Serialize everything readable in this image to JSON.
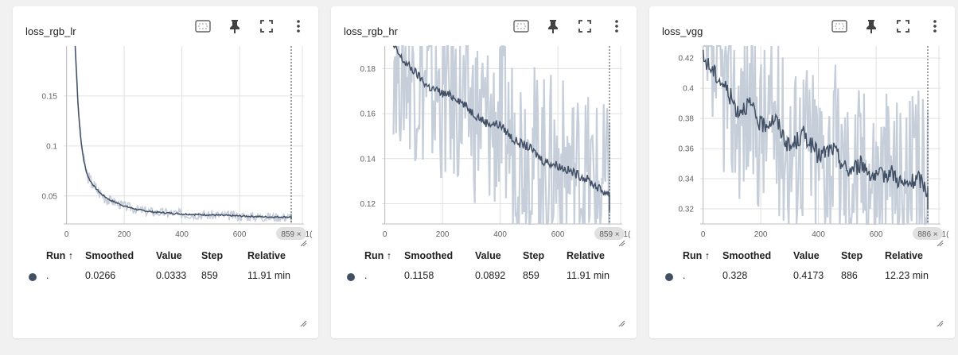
{
  "cards": [
    {
      "title": "loss_rgb_lr",
      "chart_data": {
        "type": "line",
        "ylim": [
          0.022,
          0.2
        ],
        "xlim": [
          -10,
          1000
        ],
        "xticks": [
          0,
          200,
          400,
          600,
          800
        ],
        "xtick_labels": [
          "0",
          "200",
          "400",
          "600",
          "8("
        ],
        "xtick_tail": "1(",
        "yticks": [
          0.05,
          0.1,
          0.15
        ],
        "ytick_labels": [
          "0.05",
          "0.1",
          "0.15"
        ],
        "cursor_step": 859,
        "cursor_label": "859 ×",
        "series": [
          {
            "name": "smoothed",
            "x": [
              30,
              40,
              50,
              60,
              70,
              80,
              100,
              120,
              150,
              200,
              250,
              300,
              400,
              500,
              600,
              700,
              800,
              859
            ],
            "y": [
              0.2,
              0.14,
              0.105,
              0.085,
              0.073,
              0.066,
              0.058,
              0.052,
              0.046,
              0.04,
              0.036,
              0.034,
              0.032,
              0.031,
              0.03,
              0.029,
              0.029,
              0.027
            ]
          },
          {
            "name": "raw",
            "x": [
              30,
              40,
              50,
              60,
              70,
              80,
              100,
              120,
              150,
              200,
              250,
              300,
              400,
              500,
              600,
              700,
              800,
              859
            ],
            "y": [
              0.2,
              0.15,
              0.115,
              0.095,
              0.08,
              0.07,
              0.062,
              0.055,
              0.05,
              0.044,
              0.04,
              0.037,
              0.035,
              0.034,
              0.033,
              0.032,
              0.031,
              0.03
            ]
          }
        ]
      },
      "table": {
        "run": ".",
        "smoothed": "0.0266",
        "value": "0.0333",
        "step": "859",
        "relative": "11.91 min"
      }
    },
    {
      "title": "loss_rgb_hr",
      "chart_data": {
        "type": "line",
        "ylim": [
          0.111,
          0.19
        ],
        "xlim": [
          -10,
          1000
        ],
        "xticks": [
          0,
          200,
          400,
          600,
          800
        ],
        "xtick_labels": [
          "0",
          "200",
          "400",
          "600",
          "8("
        ],
        "xtick_tail": "1(",
        "yticks": [
          0.12,
          0.14,
          0.16,
          0.18
        ],
        "ytick_labels": [
          "0.12",
          "0.14",
          "0.16",
          "0.18"
        ],
        "cursor_step": 859,
        "cursor_label": "859 ×",
        "series": [
          {
            "name": "smoothed",
            "x": [
              30,
              60,
              100,
              150,
              200,
              250,
              300,
              350,
              400,
              450,
              500,
              550,
              600,
              650,
              700,
              750,
              800,
              859
            ],
            "y": [
              0.19,
              0.184,
              0.179,
              0.172,
              0.169,
              0.167,
              0.161,
              0.156,
              0.155,
              0.148,
              0.145,
              0.139,
              0.137,
              0.134,
              0.131,
              0.126,
              0.123,
              0.117
            ]
          },
          {
            "name": "raw",
            "x": [
              30,
              100,
              200,
              300,
              400,
              500,
              600,
              700,
              800,
              859
            ],
            "y": [
              0.19,
              0.16,
              0.17,
              0.15,
              0.16,
              0.14,
              0.13,
              0.12,
              0.12,
              0.115
            ]
          }
        ]
      },
      "table": {
        "run": ".",
        "smoothed": "0.1158",
        "value": "0.0892",
        "step": "859",
        "relative": "11.91 min"
      }
    },
    {
      "title": "loss_vgg",
      "chart_data": {
        "type": "line",
        "ylim": [
          0.31,
          0.428
        ],
        "xlim": [
          -10,
          1000
        ],
        "xticks": [
          0,
          200,
          400,
          600,
          800
        ],
        "xtick_labels": [
          "0",
          "200",
          "400",
          "600",
          "80("
        ],
        "xtick_tail": "1(",
        "yticks": [
          0.32,
          0.34,
          0.36,
          0.38,
          0.4,
          0.42
        ],
        "ytick_labels": [
          "0.32",
          "0.34",
          "0.36",
          "0.38",
          "0.4",
          "0.42"
        ],
        "cursor_step": 886,
        "cursor_label": "886 ×",
        "series": [
          {
            "name": "smoothed",
            "x": [
              0,
              40,
              80,
              120,
              160,
              200,
              250,
              300,
              350,
              400,
              450,
              500,
              550,
              600,
              650,
              700,
              750,
              800,
              850,
              886
            ],
            "y": [
              0.42,
              0.41,
              0.4,
              0.385,
              0.39,
              0.375,
              0.38,
              0.36,
              0.37,
              0.355,
              0.36,
              0.345,
              0.35,
              0.34,
              0.345,
              0.335,
              0.34,
              0.325,
              0.33,
              0.33
            ]
          },
          {
            "name": "raw",
            "x": [
              0,
              200,
              400,
              600,
              800,
              886
            ],
            "y": [
              0.42,
              0.37,
              0.36,
              0.34,
              0.33,
              0.417
            ]
          }
        ]
      },
      "table": {
        "run": ".",
        "smoothed": "0.328",
        "value": "0.4173",
        "step": "886",
        "relative": "12.23 min"
      }
    }
  ],
  "table_headers": {
    "run": "Run ↑",
    "smoothed": "Smoothed",
    "value": "Value",
    "step": "Step",
    "relative": "Relative"
  },
  "icons": {
    "fit": "fit-domain-icon",
    "pin": "pin-icon",
    "fullscreen": "fullscreen-icon",
    "more": "more-vert-icon",
    "resize": "resize-icon"
  },
  "colors": {
    "smoothed": "#425066",
    "raw": "#c3cbd8",
    "run_dot": "#425066"
  }
}
